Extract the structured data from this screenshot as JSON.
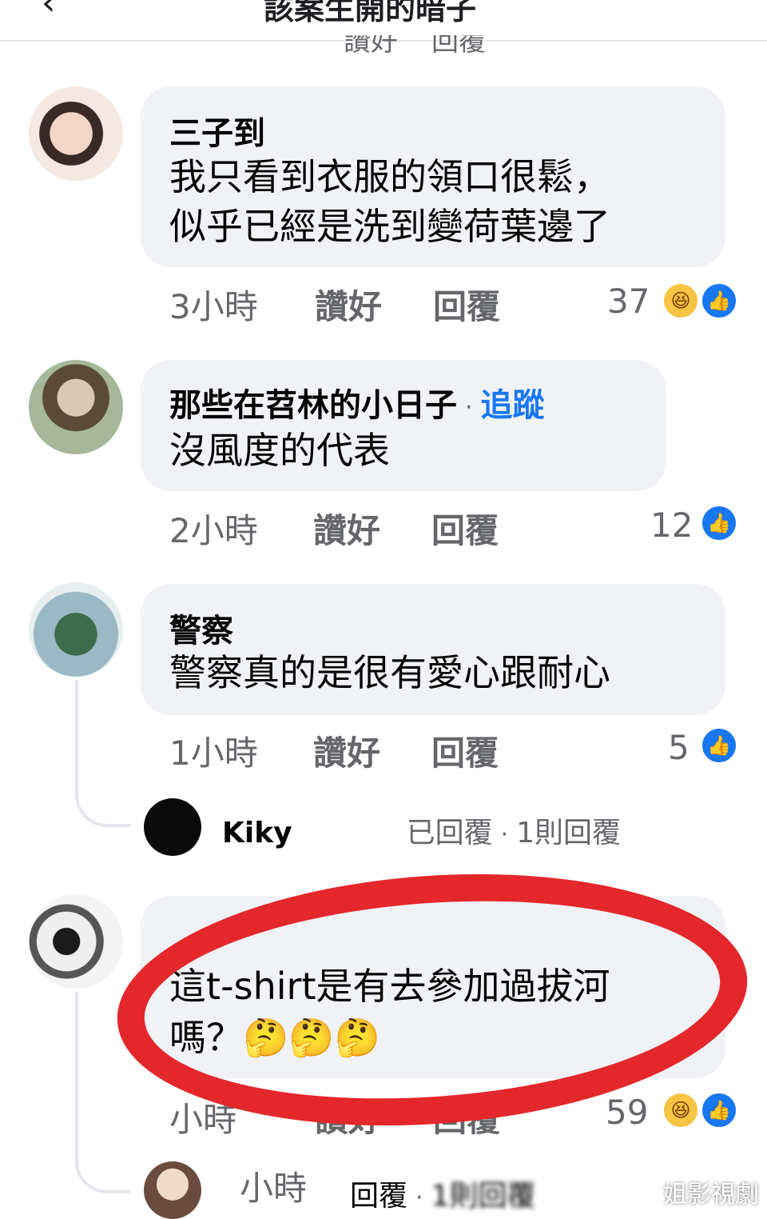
{
  "header": {
    "title": "該案生開的暗子",
    "back_icon": "back-arrow-icon"
  },
  "comments": [
    {
      "author": "三子到",
      "lines": [
        "我只看到衣服的領口很鬆，",
        "似乎已經是洗到變荷葉邊了"
      ],
      "time": "3小時",
      "like": "讚好",
      "reply": "回覆",
      "reaction_count": "37",
      "reactions": [
        "haha-icon",
        "like-icon"
      ]
    },
    {
      "author": "那些在苕林的小日子",
      "follow": "追蹤",
      "lines": [
        "沒風度的代表"
      ],
      "time": "2小時",
      "like": "讚好",
      "reply": "回覆",
      "reaction_count": "12",
      "reactions": [
        "like-icon"
      ]
    },
    {
      "author": "警察",
      "lines": [
        "警察真的是很有愛心跟耐心"
      ],
      "time": "1小時",
      "like": "讚好",
      "reply": "回覆",
      "reaction_count": "5",
      "reactions": [
        "like-icon"
      ],
      "reply_summary": {
        "name": "Kiky",
        "text": "已回覆",
        "count": "1則回覆"
      }
    },
    {
      "author": "",
      "lines": [
        "這t-shirt是有去參加過拔河",
        "嗎？🤔🤔🤔"
      ],
      "time": "小時",
      "like": "讚好",
      "reply": "回覆",
      "reaction_count": "59",
      "reactions": [
        "haha-icon",
        "like-icon"
      ],
      "reply_summary": {
        "time": "小時",
        "text": "回覆",
        "count": "1則回覆"
      }
    }
  ],
  "colors": {
    "link": "#1877f2",
    "bubble": "#f0f2f5",
    "annotation": "#e3272b"
  },
  "watermark": "姐影視劇"
}
